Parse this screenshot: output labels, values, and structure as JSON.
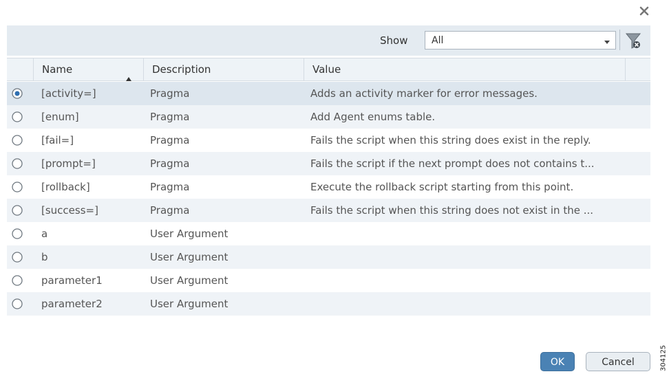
{
  "toolbar": {
    "show_label": "Show",
    "show_value": "All"
  },
  "table": {
    "headers": {
      "name": "Name",
      "description": "Description",
      "value": "Value"
    },
    "rows": [
      {
        "name": "[activity=]",
        "description": "Pragma",
        "value": "Adds an activity marker for error messages.",
        "selected": true
      },
      {
        "name": "[enum]",
        "description": "Pragma",
        "value": "Add Agent enums table.",
        "selected": false
      },
      {
        "name": "[fail=]",
        "description": "Pragma",
        "value": "Fails the script when this string does exist in the reply.",
        "selected": false
      },
      {
        "name": "[prompt=]",
        "description": "Pragma",
        "value": "Fails the script if the next prompt does not contains t...",
        "selected": false
      },
      {
        "name": "[rollback]",
        "description": "Pragma",
        "value": "Execute the rollback script starting from this point.",
        "selected": false
      },
      {
        "name": "[success=]",
        "description": "Pragma",
        "value": "Fails the script when this string does not exist in the ...",
        "selected": false
      },
      {
        "name": "a",
        "description": "User Argument",
        "value": "",
        "selected": false
      },
      {
        "name": "b",
        "description": "User Argument",
        "value": "",
        "selected": false
      },
      {
        "name": "parameter1",
        "description": "User Argument",
        "value": "",
        "selected": false
      },
      {
        "name": "parameter2",
        "description": "User Argument",
        "value": "",
        "selected": false
      }
    ]
  },
  "buttons": {
    "ok": "OK",
    "cancel": "Cancel"
  },
  "figure_id": "304125",
  "colors": {
    "accent": "#4a82b4",
    "selected_row": "#dde6ee",
    "alt_row": "#eff3f7",
    "toolbar": "#e4ebf1"
  }
}
